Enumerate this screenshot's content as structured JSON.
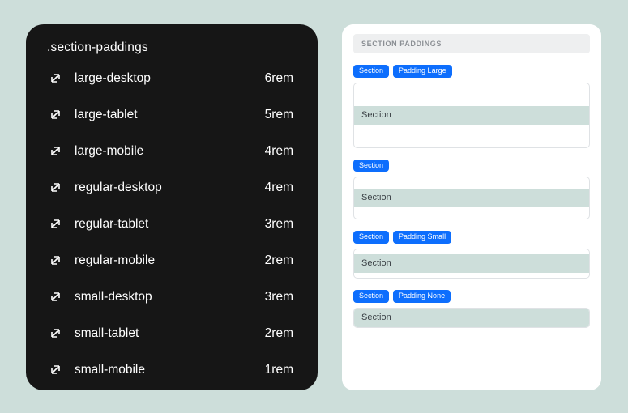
{
  "left": {
    "title": ".section-paddings",
    "rows": [
      {
        "label": "large-desktop",
        "value": "6rem"
      },
      {
        "label": "large-tablet",
        "value": "5rem"
      },
      {
        "label": "large-mobile",
        "value": "4rem"
      },
      {
        "label": "regular-desktop",
        "value": "4rem"
      },
      {
        "label": "regular-tablet",
        "value": "3rem"
      },
      {
        "label": "regular-mobile",
        "value": "2rem"
      },
      {
        "label": "small-desktop",
        "value": "3rem"
      },
      {
        "label": "small-tablet",
        "value": "2rem"
      },
      {
        "label": "small-mobile",
        "value": "1rem"
      }
    ]
  },
  "right": {
    "header": "SECTION PADDINGS",
    "examples": [
      {
        "tags": [
          "Section",
          "Padding Large"
        ],
        "inner": "Section",
        "variant": "large"
      },
      {
        "tags": [
          "Section"
        ],
        "inner": "Section",
        "variant": "regular"
      },
      {
        "tags": [
          "Section",
          "Padding Small"
        ],
        "inner": "Section",
        "variant": "small"
      },
      {
        "tags": [
          "Section",
          "Padding None"
        ],
        "inner": "Section",
        "variant": "none"
      }
    ]
  },
  "colors": {
    "page_bg": "#cddeda",
    "left_bg": "#161616",
    "right_bg": "#ffffff",
    "tag_bg": "#0d6efd",
    "header_bg": "#eeeff0",
    "inner_bar_bg": "#cddeda"
  }
}
